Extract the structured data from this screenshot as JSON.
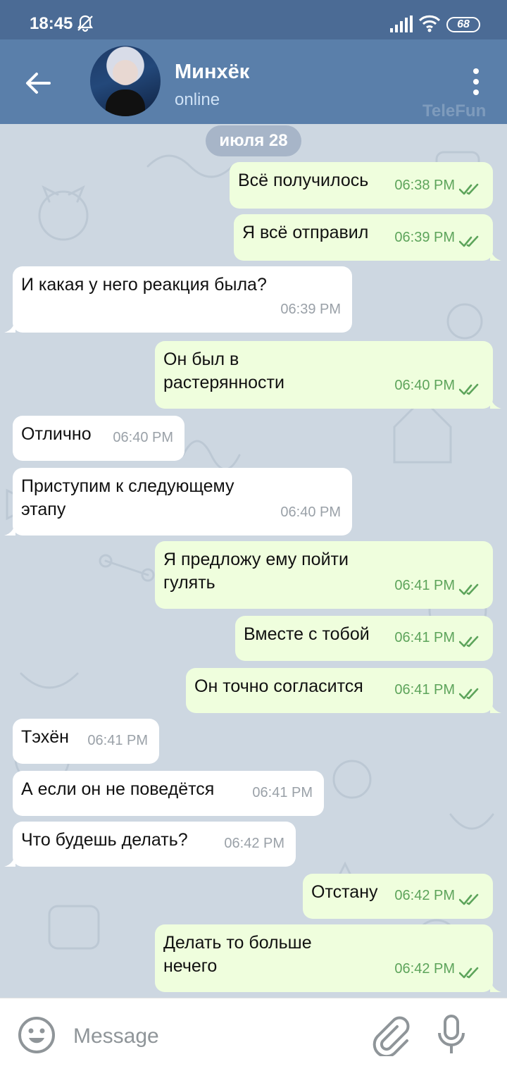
{
  "status_bar": {
    "time": "18:45",
    "battery": "68",
    "icons": [
      "bell-off-icon",
      "signal-icon",
      "wifi-icon",
      "battery-icon"
    ]
  },
  "header": {
    "name": "Минхёк",
    "status": "online",
    "watermark": "TeleFun",
    "icons": [
      "back-arrow-icon",
      "more-vertical-icon"
    ]
  },
  "chat": {
    "date": "июля 28",
    "messages": [
      {
        "dir": "out",
        "text": "Всё получилось",
        "time": "06:38 PM",
        "read": true
      },
      {
        "dir": "out",
        "text": "Я всё отправил",
        "time": "06:39 PM",
        "read": true
      },
      {
        "dir": "in",
        "text": "И какая у него реакция была?",
        "time": "06:39 PM"
      },
      {
        "dir": "out",
        "text": "Он был в\nрастерянности",
        "time": "06:40 PM",
        "read": true
      },
      {
        "dir": "in",
        "text": "Отлично",
        "time": "06:40 PM"
      },
      {
        "dir": "in",
        "text": "Приступим к следующему\nэтапу",
        "time": "06:40 PM"
      },
      {
        "dir": "out",
        "text": "Я предложу ему пойти\nгулять",
        "time": "06:41 PM",
        "read": true
      },
      {
        "dir": "out",
        "text": "Вместе с тобой",
        "time": "06:41 PM",
        "read": true
      },
      {
        "dir": "out",
        "text": "Он точно согласится",
        "time": "06:41 PM",
        "read": true
      },
      {
        "dir": "in",
        "text": "Тэхён",
        "time": "06:41 PM"
      },
      {
        "dir": "in",
        "text": "А если он не поведётся",
        "time": "06:41 PM"
      },
      {
        "dir": "in",
        "text": "Что будешь делать?",
        "time": "06:42 PM"
      },
      {
        "dir": "out",
        "text": "Отстану",
        "time": "06:42 PM",
        "read": true
      },
      {
        "dir": "out",
        "text": "Делать то больше\nнечего",
        "time": "06:42 PM",
        "read": true
      }
    ]
  },
  "input_bar": {
    "placeholder": "Message",
    "value": "",
    "icons": [
      "emoji-icon",
      "paperclip-icon",
      "microphone-icon"
    ]
  },
  "colors": {
    "header": "#5a7faa",
    "status_bar": "#4b6b95",
    "outgoing_bubble": "#effedd",
    "incoming_bubble": "#ffffff",
    "read_check": "#5da45b",
    "chat_background": "#cdd7e1"
  }
}
